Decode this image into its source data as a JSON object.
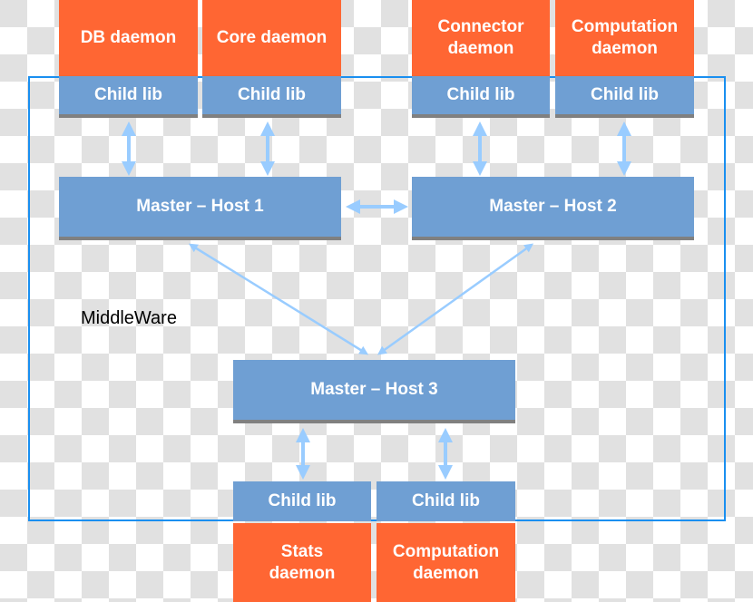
{
  "daemons_top": [
    "DB daemon",
    "Core daemon",
    "Connector daemon",
    "Computation daemon"
  ],
  "child_lib": "Child lib",
  "masters": [
    "Master – Host 1",
    "Master – Host 2",
    "Master – Host 3"
  ],
  "daemons_bottom": [
    "Stats daemon",
    "Computation daemon"
  ],
  "middleware_label": "MiddleWare",
  "colors": {
    "daemon": "#ff6633",
    "lib": "#6f9fd3",
    "arrow": "#99ccff",
    "frame": "#1a8ff0"
  }
}
